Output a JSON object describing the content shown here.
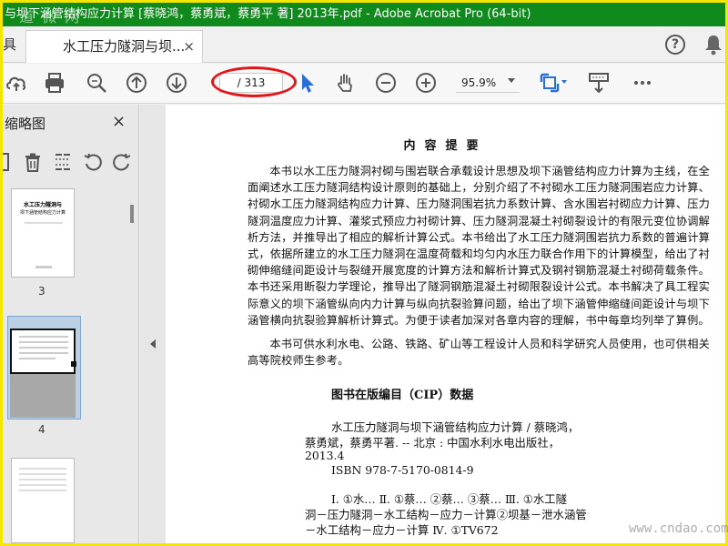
{
  "titlebar": {
    "title": "与坝下涵管结构应力计算 [蔡晓鸿，蔡勇斌，蔡勇平 著] 2013年.pdf - Adobe Acrobat Pro (64-bit)",
    "watermark": "道 微 网"
  },
  "tabs": {
    "left_fragment": "具",
    "active_label": "水工压力隧洞与坝...",
    "close_glyph": "×"
  },
  "header": {
    "help_glyph": "?"
  },
  "toolbar": {
    "page_indicator": "/ 313",
    "zoom": "95.9%"
  },
  "sidebar": {
    "title": "缩略图",
    "close_glyph": "×",
    "thumbnails": [
      {
        "label": "3",
        "thumb_title": "水工压力隧洞与",
        "thumb_subtitle": "坝下涵管结构应力计算"
      },
      {
        "label": "4"
      }
    ]
  },
  "document": {
    "heading": "内容提要",
    "paragraphs": [
      "本书以水工压力隧洞衬砌与围岩联合承载设计思想及坝下涵管结构应力计算为主线，在全面阐述水工压力隧洞结构设计原则的基础上，分别介绍了不衬砌水工压力隧洞围岩应力计算、衬砌水工压力隧洞结构应力计算、压力隧洞围岩抗力系数计算、含水围岩衬砌应力计算、压力隧洞温度应力计算、灌浆式预应力衬砌计算、压力隧洞混凝土衬砌裂设计的有限元变位协调解析方法，并推导出了相应的解析计算公式。本书给出了水工压力隧洞围岩抗力系数的普遍计算式，依据所建立的水工压力隧洞在温度荷载和均匀内水压力联合作用下的计算模型，给出了衬砌伸缩缝间距设计与裂缝开展宽度的计算方法和解析计算式及钢衬钢筋混凝土衬砌荷载条件。本书还采用断裂力学理论，推导出了隧洞钢筋混凝土衬砌限裂设计公式。本书解决了具工程实际意义的坝下涵管纵向内力计算与纵向抗裂验算问题，给出了坝下涵管伸缩缝间距设计与坝下涵管横向抗裂验算解析计算式。为便于读者加深对各章内容的理解，书中每章均列举了算例。",
      "本书可供水利水电、公路、铁路、矿山等工程设计人员和科学研究人员使用，也可供相关高等院校师生参考。"
    ],
    "cip_title": "图书在版编目（CIP）数据",
    "cip_lines": [
      "水工压力隧洞与坝下涵管结构应力计算 / 蔡晓鸿，",
      "蔡勇斌，蔡勇平著. -- 北京 : 中国水利水电出版社，",
      "2013.4",
      "ISBN 978-7-5170-0814-9",
      "Ⅰ. ①水… Ⅱ. ①蔡… ②蔡… ③蔡… Ⅲ. ①水工隧",
      "洞－压力隧洞－水工结构－应力－计算②坝基－泄水涵管",
      "－水工结构－应力－计算 Ⅳ. ①TV672"
    ],
    "site_watermark": "www.cndao.com"
  },
  "colors": {
    "titlebar": "#108a1d",
    "highlight_ellipse": "#e0161a",
    "cursor": "#2a6fd6",
    "frame": "#f5e600"
  }
}
